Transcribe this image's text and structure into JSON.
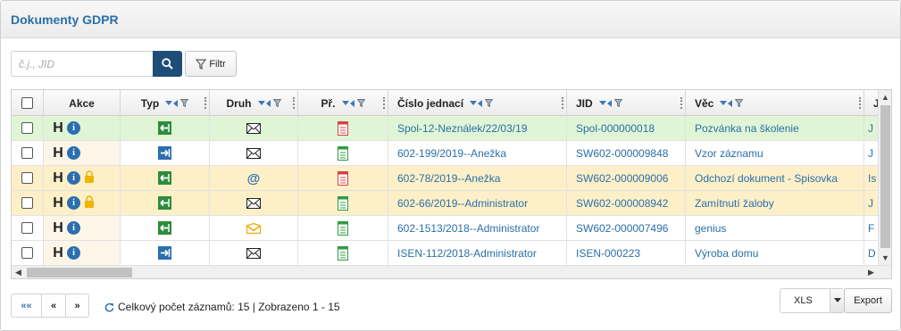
{
  "panel": {
    "title": "Dokumenty GDPR"
  },
  "search": {
    "placeholder": "č.j., JID",
    "value": ""
  },
  "toolbar": {
    "filter_label": "Filtr"
  },
  "columns": {
    "akce": "Akce",
    "typ": "Typ",
    "druh": "Druh",
    "pr": "Př.",
    "cislo": "Číslo jednací",
    "jid": "JID",
    "vec": "Věc",
    "overflow": "J"
  },
  "row_colors": {
    "green": "#dff5d6",
    "beige": "#fdf0c8",
    "plain": "#ffffff",
    "akce_bg": "#fdf6e8"
  },
  "rows": [
    {
      "bg": "green",
      "lock": false,
      "typ": "inbound",
      "druh": "envelope",
      "pr": "red",
      "cislo": "Spol-12-Neználek/22/03/19",
      "jid": "Spol-000000018",
      "vec": "Pozvánka na školenie",
      "extra": "J"
    },
    {
      "bg": "plain",
      "lock": false,
      "typ": "outbound",
      "druh": "envelope",
      "pr": "green",
      "cislo": "602-199/2019--Anežka",
      "jid": "SW602-000009848",
      "vec": "Vzor záznamu",
      "extra": "J"
    },
    {
      "bg": "beige",
      "lock": true,
      "typ": "inbound",
      "druh": "at",
      "pr": "red",
      "cislo": "602-78/2019--Anežka",
      "jid": "SW602-000009006",
      "vec": "Odchozí dokument - Spisovka",
      "extra": "Is"
    },
    {
      "bg": "beige",
      "lock": true,
      "typ": "inbound",
      "druh": "envelope",
      "pr": "green",
      "cislo": "602-66/2019--Administrator",
      "jid": "SW602-000008942",
      "vec": "Zamítnutí žaloby",
      "extra": "J"
    },
    {
      "bg": "plain",
      "lock": false,
      "typ": "inbound",
      "druh": "envelope-open",
      "pr": "green",
      "cislo": "602-1513/2018--Administrator",
      "jid": "SW602-000007496",
      "vec": "genius",
      "extra": "F"
    },
    {
      "bg": "plain",
      "lock": false,
      "typ": "outbound",
      "druh": "envelope",
      "pr": "green",
      "cislo": "ISEN-112/2018-Administrator",
      "jid": "ISEN-000223",
      "vec": "Výroba domu",
      "extra": "D"
    }
  ],
  "icons": {
    "search": "search-icon",
    "filter": "funnel-icon",
    "inbound": "arrow-in-icon",
    "outbound": "arrow-out-icon",
    "envelope": "envelope-icon",
    "at": "at-icon",
    "envelope-open": "envelope-open-icon",
    "document": "document-icon",
    "lock": "lock-icon",
    "info": "info-icon",
    "refresh": "refresh-icon"
  },
  "colors": {
    "accent": "#2a6fa8",
    "search_btn": "#1e4e77",
    "typ_green": "#2e8b3e",
    "typ_blue": "#2c6fb0",
    "doc_red": "#d84040",
    "doc_green": "#2e9b44",
    "lock": "#f0b400",
    "at": "#2c6fb0",
    "open_env": "#f0a800"
  },
  "row_h_label": "H",
  "info_label": "i",
  "pagination": {
    "first": "««",
    "prev": "«",
    "next": "»"
  },
  "status": {
    "text": "Celkový počet záznamů: 15 | Zobrazeno 1 - 15"
  },
  "export": {
    "format": "XLS",
    "button": "Export"
  }
}
